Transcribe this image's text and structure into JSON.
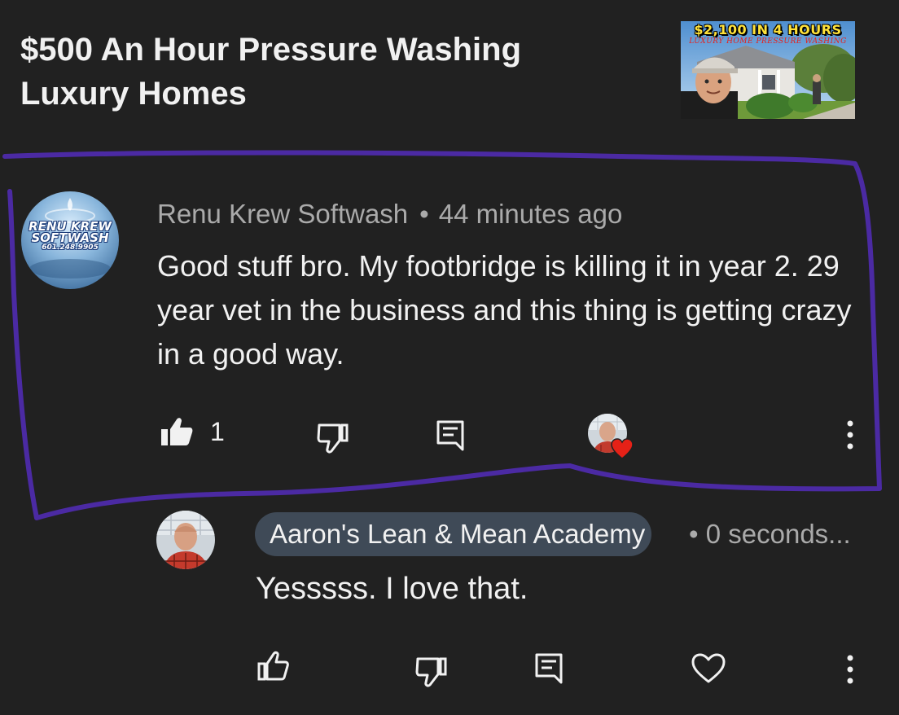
{
  "video": {
    "title": "$500 An Hour Pressure Washing Luxury Homes",
    "thumbnail_title": "$2,100 IN 4 HOURS",
    "thumbnail_subtitle": "LUXURY HOME PRESSURE WASHING"
  },
  "comment": {
    "avatar_line1": "RENU KREW",
    "avatar_line2": "SOFTWASH",
    "avatar_phone": "601.248.9905",
    "author": "Renu Krew Softwash",
    "separator": "•",
    "time": "44 minutes ago",
    "text": "Good stuff bro. My footbridge is killing it in year 2. 29 year vet in the business and this thing is getting crazy in a good way.",
    "like_count": "1",
    "icons": {
      "like": "thumbs-up-filled-icon",
      "dislike": "thumbs-down-icon",
      "reply": "reply-icon",
      "creator_heart": "creator-heart-icon",
      "more": "more-vertical-icon"
    }
  },
  "reply": {
    "author": "Aaron's Lean & Mean Academy",
    "separator": "•",
    "time": "0 seconds...",
    "text": "Yesssss. I love that.",
    "icons": {
      "like": "thumbs-up-icon",
      "dislike": "thumbs-down-icon",
      "reply": "reply-icon",
      "heart": "heart-outline-icon",
      "more": "more-vertical-icon"
    }
  },
  "colors": {
    "background": "#212121",
    "highlight_stroke": "#4b2aa3",
    "heart_red": "#e62117",
    "author_chip": "#3f4a57",
    "meta_text": "#aaaaaa"
  }
}
